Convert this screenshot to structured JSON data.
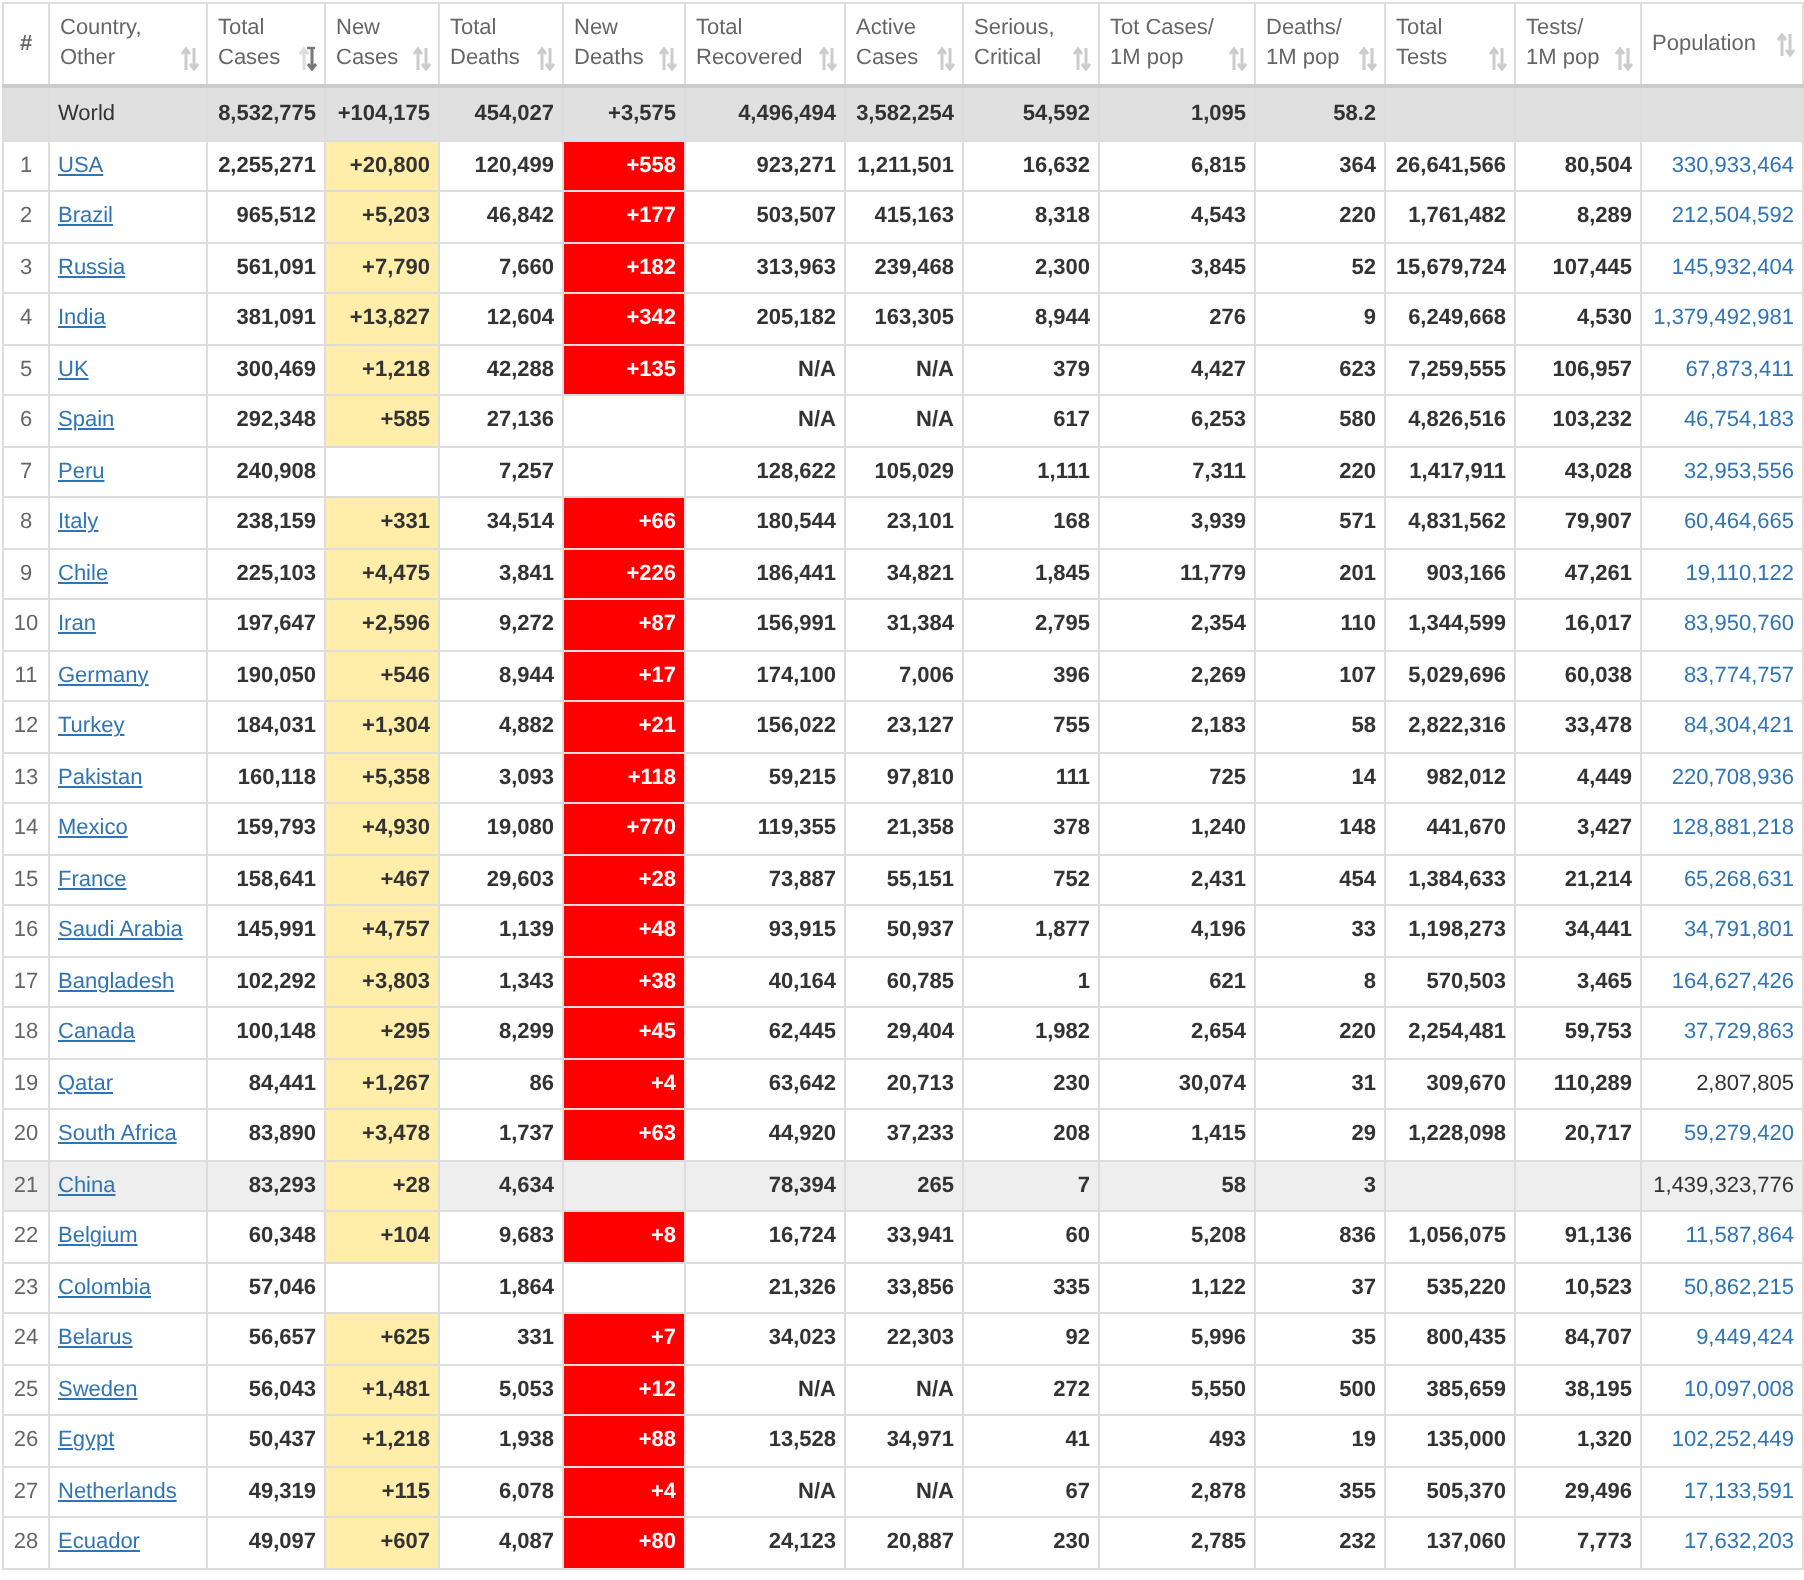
{
  "table": {
    "columns": [
      {
        "lines": [
          "#"
        ],
        "sortable": false
      },
      {
        "lines": [
          "Country,",
          "Other"
        ],
        "sortable": true,
        "sorted": false
      },
      {
        "lines": [
          "Total",
          "Cases"
        ],
        "sortable": true,
        "sorted": true
      },
      {
        "lines": [
          "New",
          "Cases"
        ],
        "sortable": true,
        "sorted": false
      },
      {
        "lines": [
          "Total",
          "Deaths"
        ],
        "sortable": true,
        "sorted": false
      },
      {
        "lines": [
          "New",
          "Deaths"
        ],
        "sortable": true,
        "sorted": false
      },
      {
        "lines": [
          "Total",
          "Recovered"
        ],
        "sortable": true,
        "sorted": false
      },
      {
        "lines": [
          "Active",
          "Cases"
        ],
        "sortable": true,
        "sorted": false
      },
      {
        "lines": [
          "Serious,",
          "Critical"
        ],
        "sortable": true,
        "sorted": false
      },
      {
        "lines": [
          "Tot Cases/",
          "1M pop"
        ],
        "sortable": true,
        "sorted": false
      },
      {
        "lines": [
          "Deaths/",
          "1M pop"
        ],
        "sortable": true,
        "sorted": false
      },
      {
        "lines": [
          "Total",
          "Tests"
        ],
        "sortable": true,
        "sorted": false
      },
      {
        "lines": [
          "Tests/",
          "1M pop"
        ],
        "sortable": true,
        "sorted": false
      },
      {
        "lines": [
          "Population"
        ],
        "sortable": true,
        "sorted": false
      }
    ],
    "rows": [
      {
        "kind": "total",
        "highlighted": true,
        "cells": [
          null,
          "World",
          "8,532,775",
          "+104,175",
          "454,027",
          "+3,575",
          "4,496,494",
          "3,582,254",
          "54,592",
          "1,095",
          "58.2",
          null,
          null,
          null
        ]
      },
      {
        "kind": "country",
        "highlighted": false,
        "population_link": true,
        "cells": [
          "1",
          "USA",
          "2,255,271",
          "+20,800",
          "120,499",
          "+558",
          "923,271",
          "1,211,501",
          "16,632",
          "6,815",
          "364",
          "26,641,566",
          "80,504",
          "330,933,464"
        ]
      },
      {
        "kind": "country",
        "highlighted": false,
        "population_link": true,
        "cells": [
          "2",
          "Brazil",
          "965,512",
          "+5,203",
          "46,842",
          "+177",
          "503,507",
          "415,163",
          "8,318",
          "4,543",
          "220",
          "1,761,482",
          "8,289",
          "212,504,592"
        ]
      },
      {
        "kind": "country",
        "highlighted": false,
        "population_link": true,
        "cells": [
          "3",
          "Russia",
          "561,091",
          "+7,790",
          "7,660",
          "+182",
          "313,963",
          "239,468",
          "2,300",
          "3,845",
          "52",
          "15,679,724",
          "107,445",
          "145,932,404"
        ]
      },
      {
        "kind": "country",
        "highlighted": false,
        "population_link": true,
        "cells": [
          "4",
          "India",
          "381,091",
          "+13,827",
          "12,604",
          "+342",
          "205,182",
          "163,305",
          "8,944",
          "276",
          "9",
          "6,249,668",
          "4,530",
          "1,379,492,981"
        ]
      },
      {
        "kind": "country",
        "highlighted": false,
        "population_link": true,
        "cells": [
          "5",
          "UK",
          "300,469",
          "+1,218",
          "42,288",
          "+135",
          "N/A",
          "N/A",
          "379",
          "4,427",
          "623",
          "7,259,555",
          "106,957",
          "67,873,411"
        ]
      },
      {
        "kind": "country",
        "highlighted": false,
        "population_link": true,
        "cells": [
          "6",
          "Spain",
          "292,348",
          "+585",
          "27,136",
          null,
          "N/A",
          "N/A",
          "617",
          "6,253",
          "580",
          "4,826,516",
          "103,232",
          "46,754,183"
        ]
      },
      {
        "kind": "country",
        "highlighted": false,
        "population_link": true,
        "cells": [
          "7",
          "Peru",
          "240,908",
          null,
          "7,257",
          null,
          "128,622",
          "105,029",
          "1,111",
          "7,311",
          "220",
          "1,417,911",
          "43,028",
          "32,953,556"
        ]
      },
      {
        "kind": "country",
        "highlighted": false,
        "population_link": true,
        "cells": [
          "8",
          "Italy",
          "238,159",
          "+331",
          "34,514",
          "+66",
          "180,544",
          "23,101",
          "168",
          "3,939",
          "571",
          "4,831,562",
          "79,907",
          "60,464,665"
        ]
      },
      {
        "kind": "country",
        "highlighted": false,
        "population_link": true,
        "cells": [
          "9",
          "Chile",
          "225,103",
          "+4,475",
          "3,841",
          "+226",
          "186,441",
          "34,821",
          "1,845",
          "11,779",
          "201",
          "903,166",
          "47,261",
          "19,110,122"
        ]
      },
      {
        "kind": "country",
        "highlighted": false,
        "population_link": true,
        "cells": [
          "10",
          "Iran",
          "197,647",
          "+2,596",
          "9,272",
          "+87",
          "156,991",
          "31,384",
          "2,795",
          "2,354",
          "110",
          "1,344,599",
          "16,017",
          "83,950,760"
        ]
      },
      {
        "kind": "country",
        "highlighted": false,
        "population_link": true,
        "cells": [
          "11",
          "Germany",
          "190,050",
          "+546",
          "8,944",
          "+17",
          "174,100",
          "7,006",
          "396",
          "2,269",
          "107",
          "5,029,696",
          "60,038",
          "83,774,757"
        ]
      },
      {
        "kind": "country",
        "highlighted": false,
        "population_link": true,
        "cells": [
          "12",
          "Turkey",
          "184,031",
          "+1,304",
          "4,882",
          "+21",
          "156,022",
          "23,127",
          "755",
          "2,183",
          "58",
          "2,822,316",
          "33,478",
          "84,304,421"
        ]
      },
      {
        "kind": "country",
        "highlighted": false,
        "population_link": true,
        "cells": [
          "13",
          "Pakistan",
          "160,118",
          "+5,358",
          "3,093",
          "+118",
          "59,215",
          "97,810",
          "111",
          "725",
          "14",
          "982,012",
          "4,449",
          "220,708,936"
        ]
      },
      {
        "kind": "country",
        "highlighted": false,
        "population_link": true,
        "cells": [
          "14",
          "Mexico",
          "159,793",
          "+4,930",
          "19,080",
          "+770",
          "119,355",
          "21,358",
          "378",
          "1,240",
          "148",
          "441,670",
          "3,427",
          "128,881,218"
        ]
      },
      {
        "kind": "country",
        "highlighted": false,
        "population_link": true,
        "cells": [
          "15",
          "France",
          "158,641",
          "+467",
          "29,603",
          "+28",
          "73,887",
          "55,151",
          "752",
          "2,431",
          "454",
          "1,384,633",
          "21,214",
          "65,268,631"
        ]
      },
      {
        "kind": "country",
        "highlighted": false,
        "population_link": true,
        "cells": [
          "16",
          "Saudi Arabia",
          "145,991",
          "+4,757",
          "1,139",
          "+48",
          "93,915",
          "50,937",
          "1,877",
          "4,196",
          "33",
          "1,198,273",
          "34,441",
          "34,791,801"
        ]
      },
      {
        "kind": "country",
        "highlighted": false,
        "population_link": true,
        "cells": [
          "17",
          "Bangladesh",
          "102,292",
          "+3,803",
          "1,343",
          "+38",
          "40,164",
          "60,785",
          "1",
          "621",
          "8",
          "570,503",
          "3,465",
          "164,627,426"
        ]
      },
      {
        "kind": "country",
        "highlighted": false,
        "population_link": true,
        "cells": [
          "18",
          "Canada",
          "100,148",
          "+295",
          "8,299",
          "+45",
          "62,445",
          "29,404",
          "1,982",
          "2,654",
          "220",
          "2,254,481",
          "59,753",
          "37,729,863"
        ]
      },
      {
        "kind": "country",
        "highlighted": false,
        "population_link": false,
        "cells": [
          "19",
          "Qatar",
          "84,441",
          "+1,267",
          "86",
          "+4",
          "63,642",
          "20,713",
          "230",
          "30,074",
          "31",
          "309,670",
          "110,289",
          "2,807,805"
        ]
      },
      {
        "kind": "country",
        "highlighted": false,
        "population_link": true,
        "cells": [
          "20",
          "South Africa",
          "83,890",
          "+3,478",
          "1,737",
          "+63",
          "44,920",
          "37,233",
          "208",
          "1,415",
          "29",
          "1,228,098",
          "20,717",
          "59,279,420"
        ]
      },
      {
        "kind": "country",
        "highlighted": true,
        "population_link": false,
        "cells": [
          "21",
          "China",
          "83,293",
          "+28",
          "4,634",
          null,
          "78,394",
          "265",
          "7",
          "58",
          "3",
          null,
          null,
          "1,439,323,776"
        ]
      },
      {
        "kind": "country",
        "highlighted": false,
        "population_link": true,
        "cells": [
          "22",
          "Belgium",
          "60,348",
          "+104",
          "9,683",
          "+8",
          "16,724",
          "33,941",
          "60",
          "5,208",
          "836",
          "1,056,075",
          "91,136",
          "11,587,864"
        ]
      },
      {
        "kind": "country",
        "highlighted": false,
        "population_link": true,
        "cells": [
          "23",
          "Colombia",
          "57,046",
          null,
          "1,864",
          null,
          "21,326",
          "33,856",
          "335",
          "1,122",
          "37",
          "535,220",
          "10,523",
          "50,862,215"
        ]
      },
      {
        "kind": "country",
        "highlighted": false,
        "population_link": true,
        "cells": [
          "24",
          "Belarus",
          "56,657",
          "+625",
          "331",
          "+7",
          "34,023",
          "22,303",
          "92",
          "5,996",
          "35",
          "800,435",
          "84,707",
          "9,449,424"
        ]
      },
      {
        "kind": "country",
        "highlighted": false,
        "population_link": true,
        "cells": [
          "25",
          "Sweden",
          "56,043",
          "+1,481",
          "5,053",
          "+12",
          "N/A",
          "N/A",
          "272",
          "5,550",
          "500",
          "385,659",
          "38,195",
          "10,097,008"
        ]
      },
      {
        "kind": "country",
        "highlighted": false,
        "population_link": true,
        "cells": [
          "26",
          "Egypt",
          "50,437",
          "+1,218",
          "1,938",
          "+88",
          "13,528",
          "34,971",
          "41",
          "493",
          "19",
          "135,000",
          "1,320",
          "102,252,449"
        ]
      },
      {
        "kind": "country",
        "highlighted": false,
        "population_link": true,
        "cells": [
          "27",
          "Netherlands",
          "49,319",
          "+115",
          "6,078",
          "+4",
          "N/A",
          "N/A",
          "67",
          "2,878",
          "355",
          "505,370",
          "29,496",
          "17,133,591"
        ]
      },
      {
        "kind": "country",
        "highlighted": false,
        "population_link": true,
        "cells": [
          "28",
          "Ecuador",
          "49,097",
          "+607",
          "4,087",
          "+80",
          "24,123",
          "20,887",
          "230",
          "2,785",
          "232",
          "137,060",
          "7,773",
          "17,632,203"
        ]
      }
    ]
  }
}
